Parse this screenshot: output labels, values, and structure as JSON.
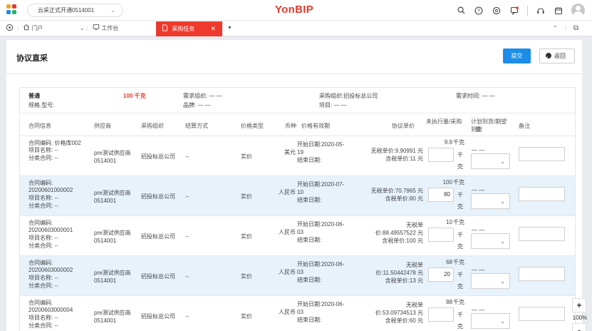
{
  "topbar": {
    "org": "云采正式开通0514001",
    "brand": "YonBIP",
    "icons": [
      "search-icon",
      "help-icon",
      "settings-icon",
      "message-icon",
      "headset-icon",
      "calendar-icon",
      "user-avatar"
    ]
  },
  "tabs": {
    "portal": "门户",
    "workbench": "工作台",
    "active": "采购任务"
  },
  "page": {
    "title": "协议直采",
    "submit": "提交",
    "back": "返回"
  },
  "info": {
    "name": "普通",
    "spec": "规格.型号:",
    "qty": "100 千克",
    "demand_org": "需求组织: — —",
    "category": "品牌: — —",
    "purchase_org": "采购组织:招投标总公司",
    "project": "项目: — —",
    "demand_time": "需求时间: — —"
  },
  "columns": {
    "contract": "合同信息",
    "supplier": "供应商",
    "purchase_org": "采购组织",
    "settle": "结算方式",
    "price_type": "价格类型",
    "currency": "币种",
    "validity": "价格有效期",
    "unit_price": "协议单价",
    "unexec_1": "未执行量/采购",
    "unexec_2": "量",
    "plan_1": "计划到货/期望",
    "plan_2": "到货",
    "remark": "备注"
  },
  "rows": [
    {
      "c1": "合同编码: 价格库002",
      "c2": "项目名称: --",
      "c3": "分类合同: --",
      "c4": "",
      "supplier1": "pre测试供应商",
      "supplier2": "0514001",
      "org": "招投标总公司",
      "settle": "--",
      "ptype": "实价",
      "currency": "美元",
      "v1": "开始日期:2020-05-",
      "v2": "19",
      "v3": "结束日期:",
      "p1": "无税单价:9.90991 元",
      "p2": "含税单价:11 元",
      "p3": "",
      "unexec": "9.9",
      "unit": "千",
      "unit2": "克",
      "unit_full": "千克",
      "qty_input": "",
      "plan": "— —"
    },
    {
      "c1": "合同编码:",
      "c2": "20200601000002",
      "c3": "项目名称: --",
      "c4": "分类合同: --",
      "supplier1": "pre测试供应商",
      "supplier2": "0514001",
      "org": "招投标总公司",
      "settle": "--",
      "ptype": "实价",
      "currency": "人民币",
      "v1": "开始日期:2020-07-",
      "v2": "10",
      "v3": "结束日期:",
      "p1": "无税单价:70.7965 元",
      "p2": "含税单价:80 元",
      "p3": "",
      "unexec": "100",
      "unit": "千",
      "unit2": "克",
      "unit_full": "千克",
      "qty_input": "80",
      "plan": "— —"
    },
    {
      "c1": "合同编码:",
      "c2": "20200603000001",
      "c3": "项目名称: --",
      "c4": "分类合同: --",
      "supplier1": "pre测试供应商",
      "supplier2": "0514001",
      "org": "招投标总公司",
      "settle": "--",
      "ptype": "实价",
      "currency": "人民币",
      "v1": "开始日期:2020-06-",
      "v2": "03",
      "v3": "结束日期:",
      "p1": "无税单",
      "p2": "价:88.49557522 元",
      "p3": "含税单价:100 元",
      "unexec": "10",
      "unit": "千",
      "unit2": "克",
      "unit_full": "千克",
      "qty_input": "",
      "plan": "— —"
    },
    {
      "c1": "合同编码:",
      "c2": "20200603000002",
      "c3": "项目名称: --",
      "c4": "分类合同: --",
      "supplier1": "pre测试供应商",
      "supplier2": "0514001",
      "org": "招投标总公司",
      "settle": "--",
      "ptype": "实价",
      "currency": "人民币",
      "v1": "开始日期:2020-06-",
      "v2": "03",
      "v3": "结束日期:",
      "p1": "无税单",
      "p2": "价:11.50442478 元",
      "p3": "含税单价:13 元",
      "unexec": "68",
      "unit": "千",
      "unit2": "克",
      "unit_full": "千克",
      "qty_input": "20",
      "plan": "— —"
    },
    {
      "c1": "合同编码:",
      "c2": "20200603000004",
      "c3": "项目名称: --",
      "c4": "分类合同: --",
      "supplier1": "pre测试供应商",
      "supplier2": "0514001",
      "org": "招投标总公司",
      "settle": "--",
      "ptype": "实价",
      "currency": "人民币",
      "v1": "开始日期:2020-06-",
      "v2": "03",
      "v3": "结束日期:",
      "p1": "无税单",
      "p2": "价:53.09734513 元",
      "p3": "含税单价:60 元",
      "unexec": "88",
      "unit": "千",
      "unit2": "克",
      "unit_full": "千克",
      "qty_input": "",
      "plan": "— —"
    }
  ],
  "zoom": {
    "plus": "+",
    "value": "100%",
    "minus": "-"
  }
}
